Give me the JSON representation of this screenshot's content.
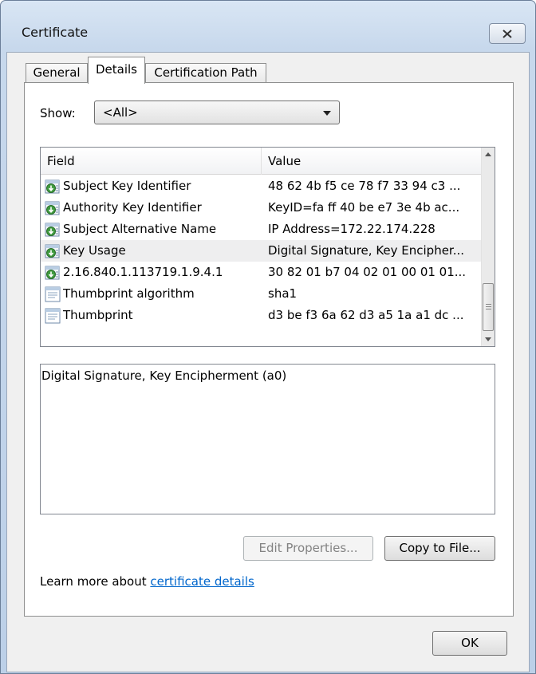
{
  "window": {
    "title": "Certificate"
  },
  "tabs": [
    {
      "label": "General",
      "active": false
    },
    {
      "label": "Details",
      "active": true
    },
    {
      "label": "Certification Path",
      "active": false
    }
  ],
  "show": {
    "label": "Show:",
    "selected": "<All>"
  },
  "list": {
    "columns": [
      "Field",
      "Value"
    ],
    "rows": [
      {
        "field": "Subject Key Identifier",
        "value": "48 62 4b f5 ce 78 f7 33 94 c3 ...",
        "icon": "cert-extension-icon"
      },
      {
        "field": "Authority Key Identifier",
        "value": "KeyID=fa ff 40 be e7 3e 4b ac...",
        "icon": "cert-extension-icon"
      },
      {
        "field": "Subject Alternative Name",
        "value": "IP Address=172.22.174.228",
        "icon": "cert-extension-icon"
      },
      {
        "field": "Key Usage",
        "value": "Digital Signature, Key Encipher...",
        "icon": "cert-extension-icon"
      },
      {
        "field": "2.16.840.1.113719.1.9.4.1",
        "value": "30 82 01 b7 04 02 01 00 01 01...",
        "icon": "cert-extension-icon"
      },
      {
        "field": "Thumbprint algorithm",
        "value": "sha1",
        "icon": "document-icon"
      },
      {
        "field": "Thumbprint",
        "value": "d3 be f3 6a 62 d3 a5 1a a1 dc ...",
        "icon": "document-icon"
      }
    ]
  },
  "detail_text": "Digital Signature, Key Encipherment (a0)",
  "buttons": {
    "edit_properties": "Edit Properties...",
    "copy_to_file": "Copy to File...",
    "ok": "OK"
  },
  "learn_more": {
    "prefix": "Learn more about ",
    "link": "certificate details"
  }
}
